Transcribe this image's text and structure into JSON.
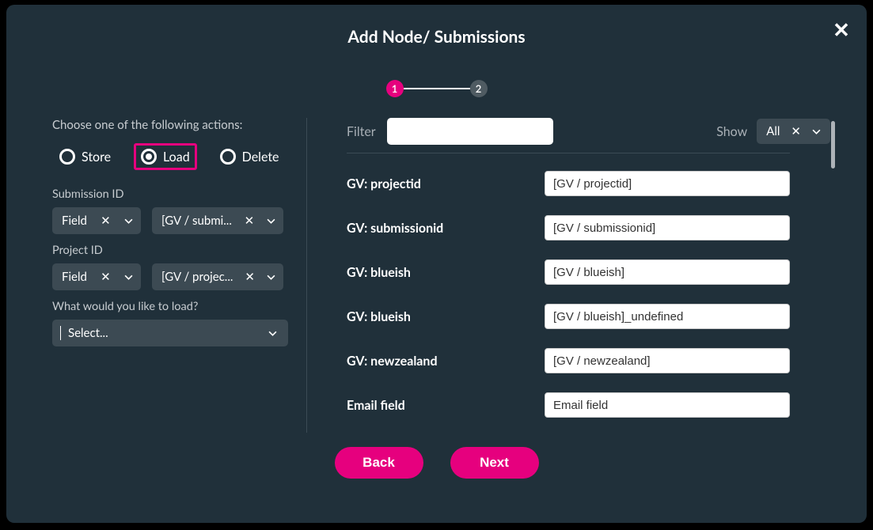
{
  "modal": {
    "title": "Add Node/ Submissions",
    "closeIcon": "close-icon"
  },
  "stepper": {
    "current": 1,
    "total": 2,
    "label1": "1",
    "label2": "2"
  },
  "left": {
    "prompt": "Choose one of the following actions:",
    "radios": {
      "store": "Store",
      "load": "Load",
      "delete": "Delete"
    },
    "submissionId": {
      "label": "Submission ID",
      "typeChip": "Field",
      "valueChip": "[GV / submi..."
    },
    "projectId": {
      "label": "Project ID",
      "typeChip": "Field",
      "valueChip": "[GV / projec..."
    },
    "loadPrompt": "What would you like to load?",
    "selectPlaceholder": "Select..."
  },
  "right": {
    "filterLabel": "Filter",
    "showLabel": "Show",
    "showValue": "All",
    "fields": [
      {
        "name": "GV: projectid",
        "value": "[GV / projectid]"
      },
      {
        "name": "GV: submissionid",
        "value": "[GV / submissionid]"
      },
      {
        "name": "GV: blueish",
        "value": "[GV / blueish]"
      },
      {
        "name": "GV: blueish",
        "value": "[GV / blueish]_undefined"
      },
      {
        "name": "GV: newzealand",
        "value": "[GV / newzealand]"
      },
      {
        "name": "Email field",
        "value": "Email field"
      }
    ]
  },
  "footer": {
    "back": "Back",
    "next": "Next"
  }
}
